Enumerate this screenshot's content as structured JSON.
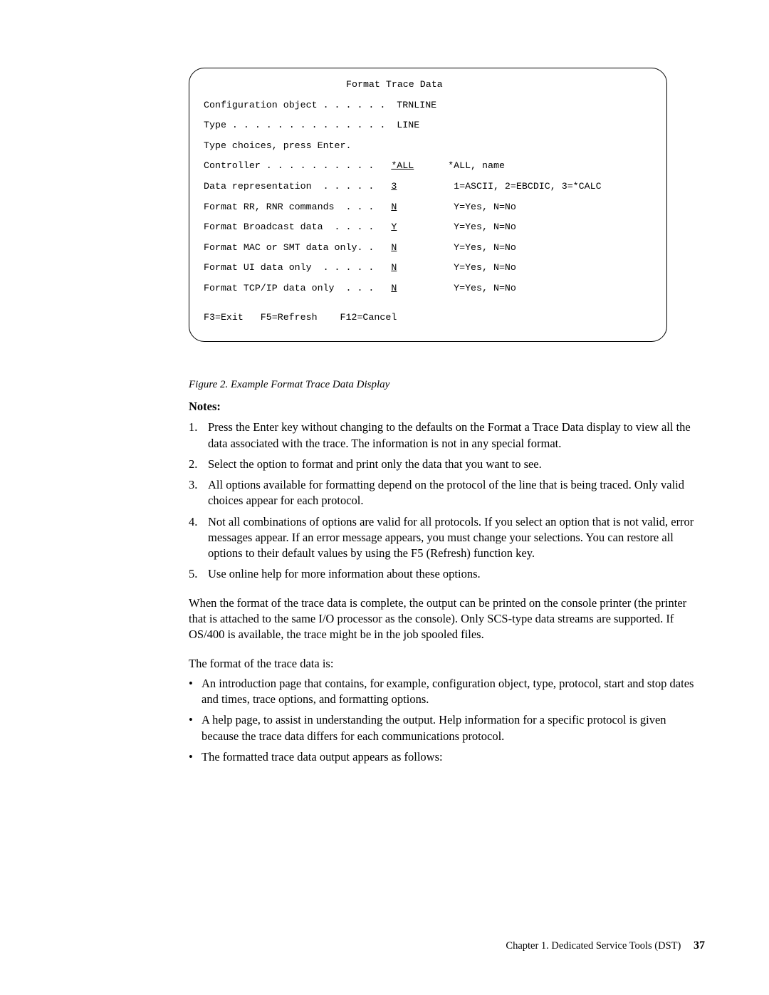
{
  "terminal": {
    "title": "Format Trace Data",
    "lines": [
      "Configuration object . . . . . .  TRNLINE",
      "Type . . . . . . . . . . . . . .  LINE",
      "Type choices, press Enter.",
      "Controller . . . . . . . . . .   *ALL       *ALL, name",
      "Data representation  . . . . .   3          1=ASCII, 2=EBCDIC, 3=*CALC",
      "Format RR, RNR commands  . . .   N          Y=Yes, N=No",
      "Format Broadcast data  . . . .   Y          Y=Yes, N=No",
      "Format MAC or SMT data only. .   N          Y=Yes, N=No",
      "Format UI data only  . . . . .   N          Y=Yes, N=No",
      "Format TCP/IP data only  . . .   N          Y=Yes, N=No",
      "F3=Exit   F5=Refresh    F12=Cancel"
    ],
    "fields": {
      "controller_label": "Controller . . . . . . . . . .   ",
      "controller_value": "*ALL",
      "controller_hint": "      *ALL, name",
      "datarep_label": "Data representation  . . . . .   ",
      "datarep_value": "3",
      "datarep_hint": "          1=ASCII, 2=EBCDIC, 3=*CALC",
      "rr_label": "Format RR, RNR commands  . . .   ",
      "rr_value": "N",
      "rr_hint": "          Y=Yes, N=No",
      "bcast_label": "Format Broadcast data  . . . .   ",
      "bcast_value": "Y",
      "bcast_hint": "          Y=Yes, N=No",
      "mac_label": "Format MAC or SMT data only. .   ",
      "mac_value": "N",
      "mac_hint": "          Y=Yes, N=No",
      "ui_label": "Format UI data only  . . . . .   ",
      "ui_value": "N",
      "ui_hint": "          Y=Yes, N=No",
      "tcp_label": "Format TCP/IP data only  . . .   ",
      "tcp_value": "N",
      "tcp_hint": "          Y=Yes, N=No"
    },
    "config_line": "Configuration object . . . . . .  TRNLINE",
    "type_line": "Type . . . . . . . . . . . . . .  LINE",
    "choices_line": "Type choices, press Enter.",
    "fkeys_line": "F3=Exit   F5=Refresh    F12=Cancel"
  },
  "caption": "Figure 2. Example Format Trace Data Display",
  "notes_heading": "Notes:",
  "notes": [
    "Press the Enter key without changing to the defaults on the Format a Trace Data display to view all the data associated with the trace. The information is not in any special format.",
    "Select the option to format and print only the data that you want to see.",
    "All options available for formatting depend on the protocol of the line that is being traced. Only valid choices appear for each protocol.",
    "Not all combinations of options are valid for all protocols. If you select an option that is not valid, error messages appear. If an error message appears, you must change your selections. You can restore all options to their default values by using the F5 (Refresh) function key.",
    "Use online help for more information about these options."
  ],
  "para1": "When the format of the trace data is complete, the output can be printed on the console printer (the printer that is attached to the same I/O processor as the console). Only SCS-type data streams are supported. If OS/400 is available, the trace might be in the job spooled files.",
  "para2": "The format of the trace data is:",
  "bullets": [
    "An introduction page that contains, for example, configuration object, type, protocol, start and stop dates and times, trace options, and formatting options.",
    "A help page, to assist in understanding the output. Help information for a specific protocol is given because the trace data differs for each communications protocol.",
    "The formatted trace data output appears as follows:"
  ],
  "footer": {
    "chapter": "Chapter 1. Dedicated Service Tools (DST)",
    "page": "37"
  }
}
